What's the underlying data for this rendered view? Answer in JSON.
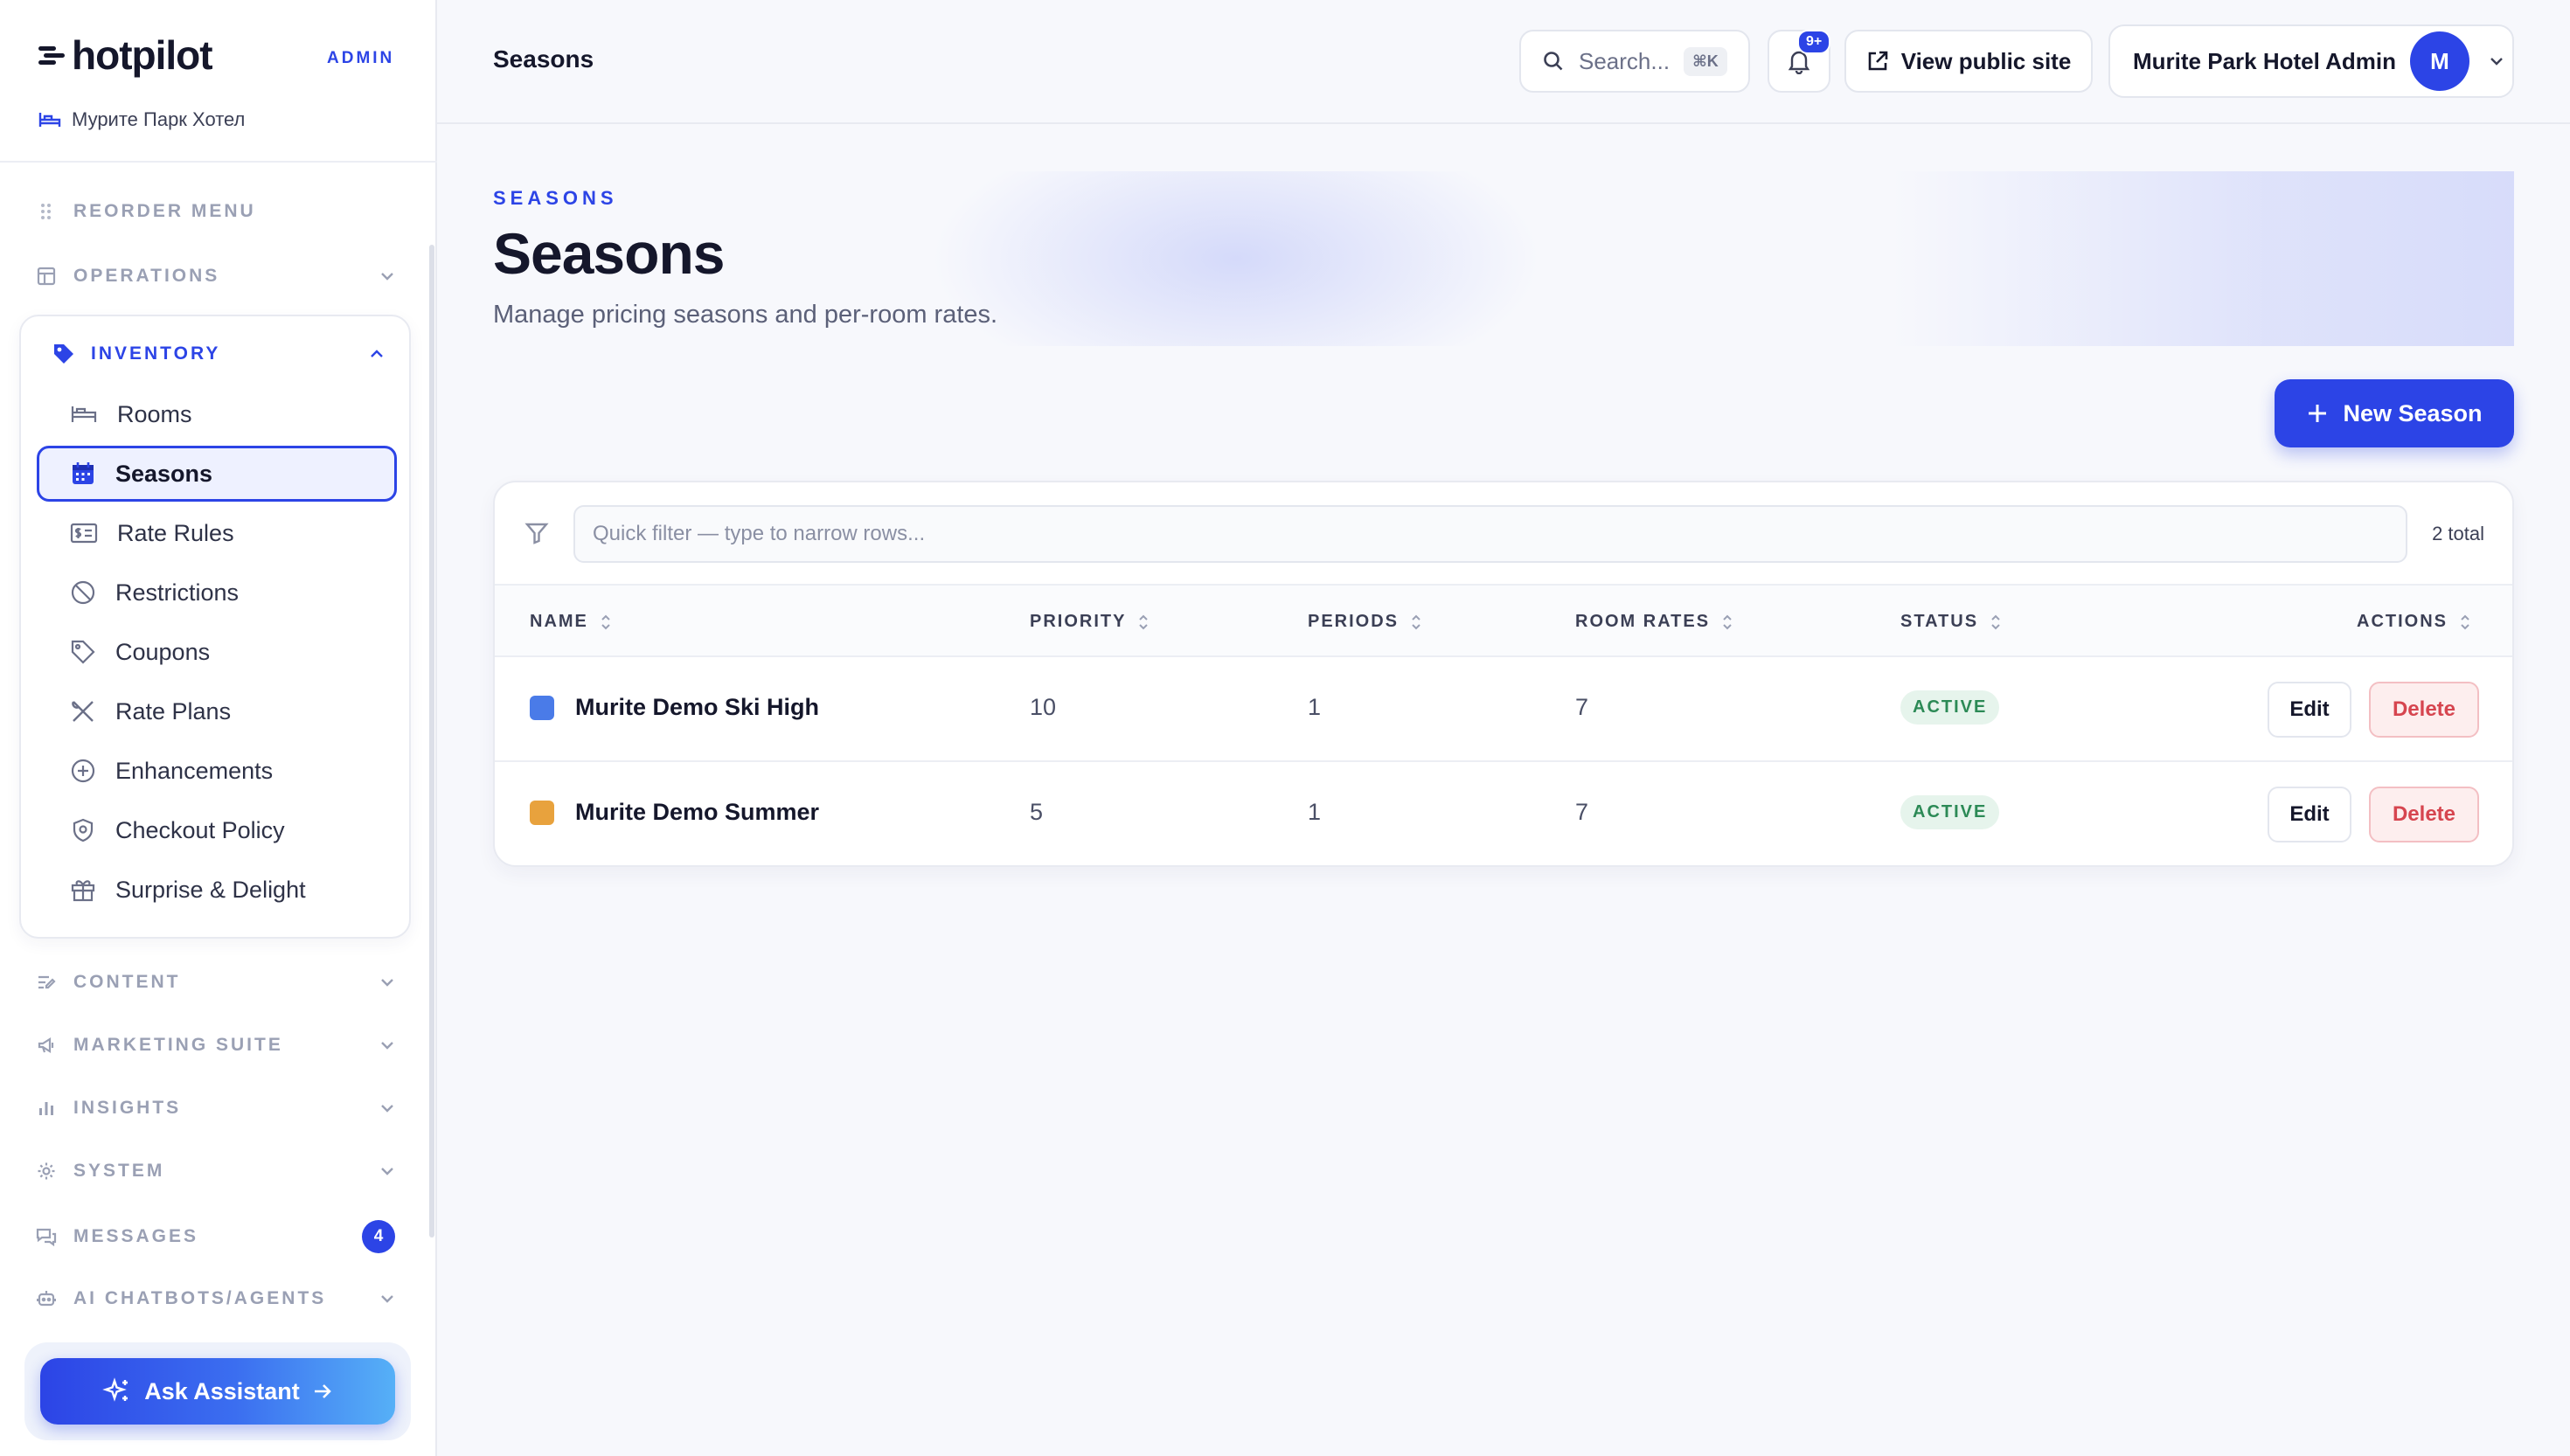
{
  "brand": {
    "name": "hotpilot",
    "tag": "ADMIN",
    "hotel": "Мурите Парк Хотел"
  },
  "sidebar": {
    "reorder_label": "REORDER MENU",
    "sections": [
      {
        "label": "OPERATIONS",
        "icon": "layout-icon"
      },
      {
        "label": "CONTENT",
        "icon": "edit-lines-icon"
      },
      {
        "label": "MARKETING SUITE",
        "icon": "megaphone-icon"
      },
      {
        "label": "INSIGHTS",
        "icon": "bar-chart-icon"
      },
      {
        "label": "SYSTEM",
        "icon": "gear-icon"
      },
      {
        "label": "MESSAGES",
        "icon": "chat-icon",
        "badge": "4"
      },
      {
        "label": "AI CHATBOTS/AGENTS",
        "icon": "bot-icon"
      }
    ],
    "inventory": {
      "label": "INVENTORY",
      "items": [
        {
          "label": "Rooms",
          "icon": "bed-icon"
        },
        {
          "label": "Seasons",
          "icon": "calendar-icon",
          "active": true
        },
        {
          "label": "Rate Rules",
          "icon": "dollar-card-icon"
        },
        {
          "label": "Restrictions",
          "icon": "ban-icon"
        },
        {
          "label": "Coupons",
          "icon": "tag-icon"
        },
        {
          "label": "Rate Plans",
          "icon": "utensils-icon"
        },
        {
          "label": "Enhancements",
          "icon": "plus-circle-icon"
        },
        {
          "label": "Checkout Policy",
          "icon": "shield-icon"
        },
        {
          "label": "Surprise & Delight",
          "icon": "gift-icon"
        }
      ]
    },
    "assistant_label": "Ask Assistant"
  },
  "topbar": {
    "breadcrumb": "Seasons",
    "search_placeholder": "Search...",
    "search_shortcut": "⌘K",
    "notifications_badge": "9+",
    "public_site_label": "View public site",
    "account_name": "Murite Park Hotel Admin",
    "avatar_initial": "M"
  },
  "page": {
    "eyebrow": "SEASONS",
    "title": "Seasons",
    "subtitle": "Manage pricing seasons and per-room rates.",
    "new_button": "New Season"
  },
  "table": {
    "filter_placeholder": "Quick filter — type to narrow rows...",
    "total": "2 total",
    "columns": [
      "NAME",
      "PRIORITY",
      "PERIODS",
      "ROOM RATES",
      "STATUS",
      "ACTIONS"
    ],
    "rows": [
      {
        "color": "#4a7be8",
        "name": "Murite Demo Ski High",
        "priority": "10",
        "periods": "1",
        "room_rates": "7",
        "status": "ACTIVE"
      },
      {
        "color": "#e8a23d",
        "name": "Murite Demo Summer",
        "priority": "5",
        "periods": "1",
        "room_rates": "7",
        "status": "ACTIVE"
      }
    ],
    "edit_label": "Edit",
    "delete_label": "Delete"
  },
  "colors": {
    "accent": "#2c44e6",
    "active_status": "#2c8a56",
    "delete": "#d6454f"
  }
}
